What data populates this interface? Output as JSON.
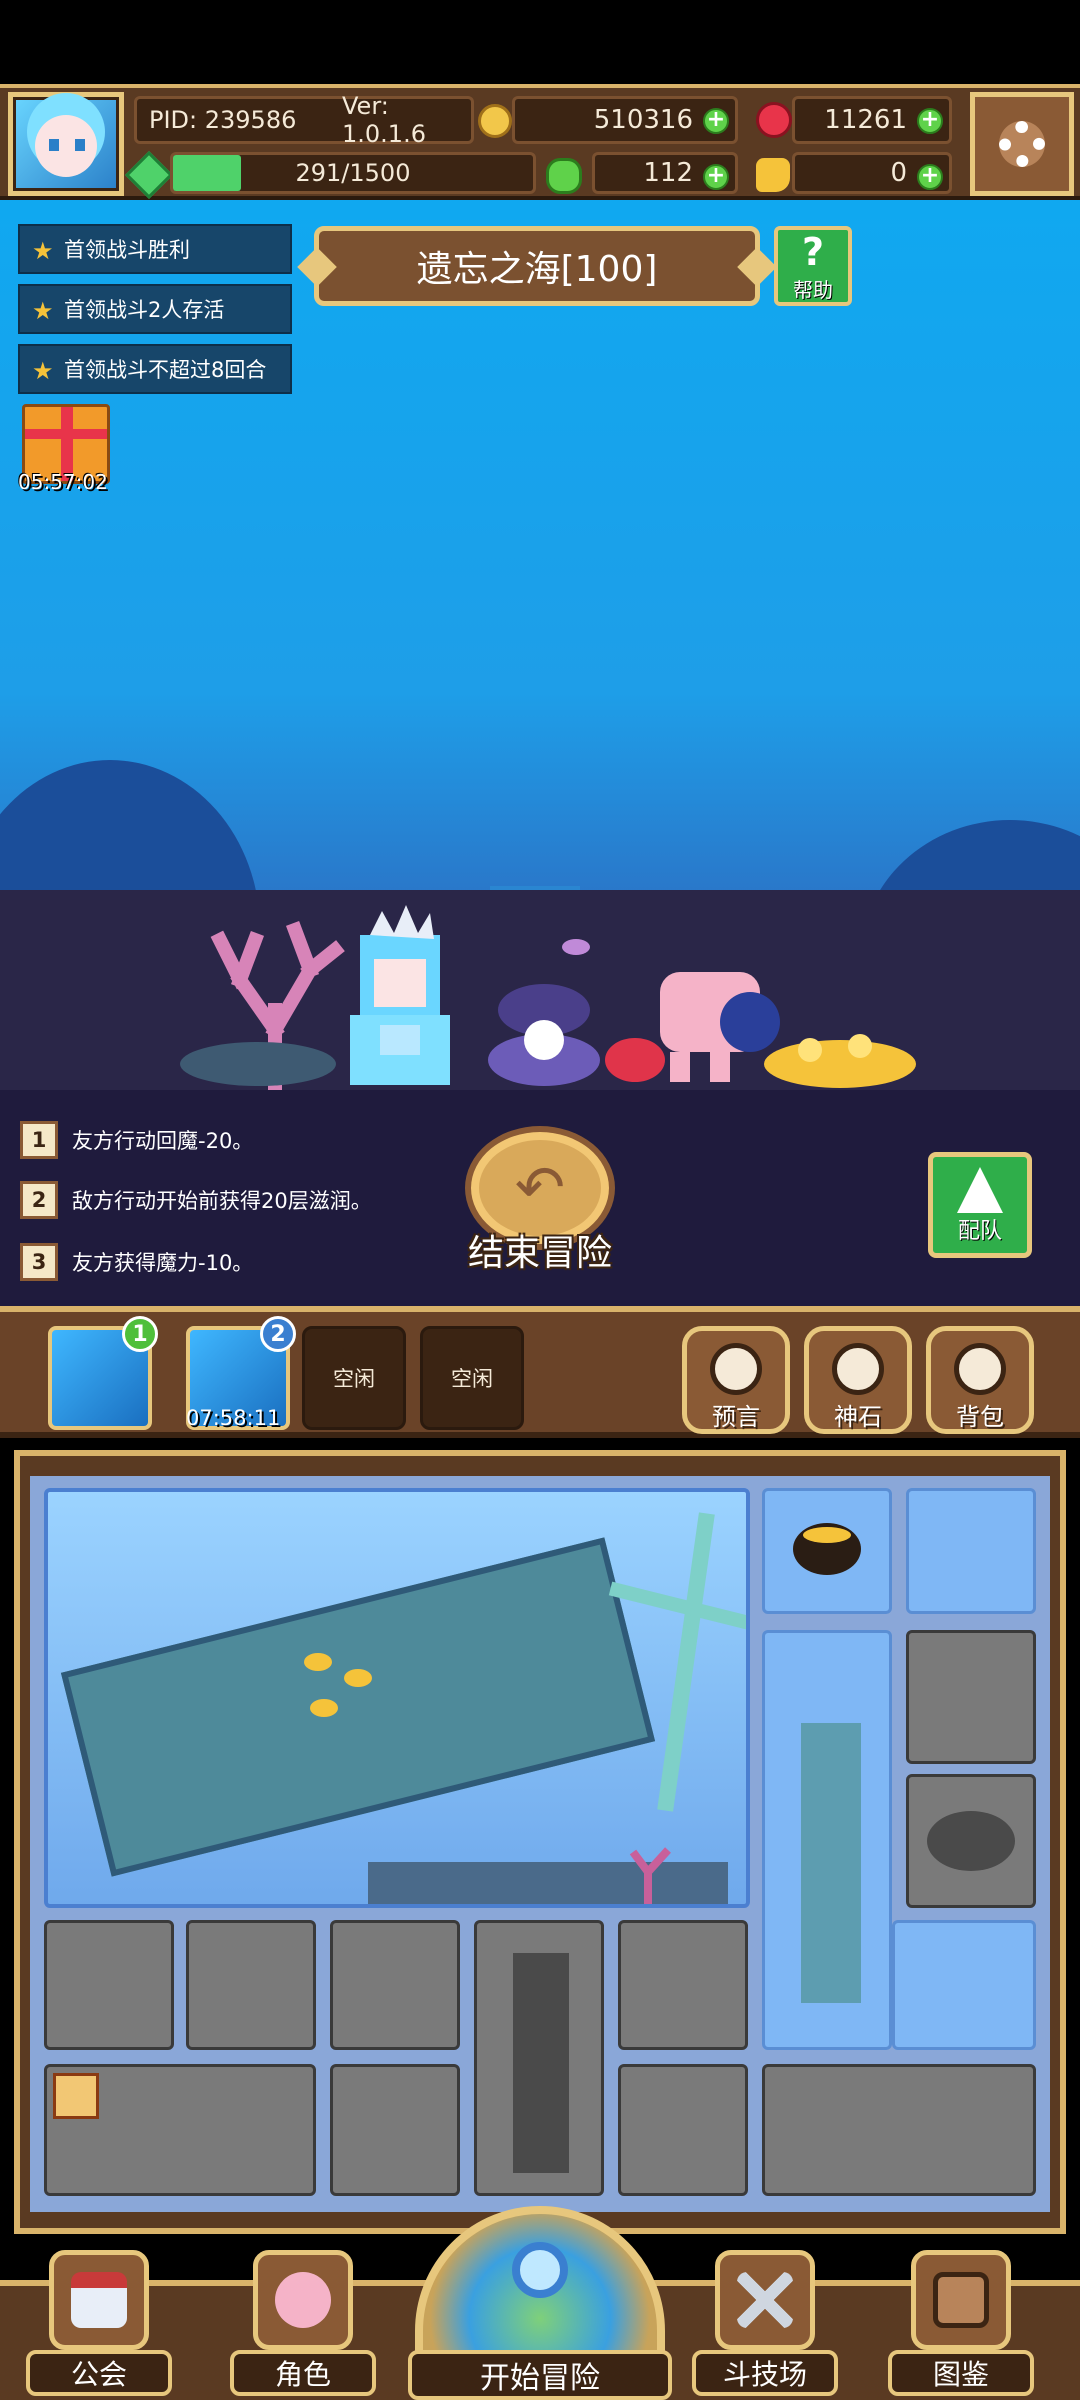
{
  "hud": {
    "pid": "PID: 239586",
    "version": "Ver: 1.0.1.6",
    "gold": "510316",
    "ruby": "11261",
    "energy": "291/1500",
    "energy_fraction": 0.19,
    "clover": "112",
    "hand": "0",
    "plus_symbol": "+"
  },
  "quests": [
    {
      "label": "首领战斗胜利"
    },
    {
      "label": "首领战斗2人存活"
    },
    {
      "label": "首领战斗不超过8回合"
    }
  ],
  "map": {
    "title": "遗忘之海[100]",
    "help_glyph": "?",
    "help_label": "帮助"
  },
  "gift": {
    "timer": "05:57:02"
  },
  "log": [
    {
      "num": "1",
      "text": "友方行动回魔-20。"
    },
    {
      "num": "2",
      "text": "敌方行动开始前获得20层滋润。"
    },
    {
      "num": "3",
      "text": "友方获得魔力-10。"
    }
  ],
  "end_button": {
    "label": "结束冒险",
    "glyph": "↶"
  },
  "team_button": {
    "label": "配队"
  },
  "slots": {
    "slot1_badge": "1",
    "slot2_badge": "2",
    "slot2_timer": "07:58:11",
    "idle1": "空闲",
    "idle2": "空闲"
  },
  "side_buttons": {
    "prophecy": "预言",
    "godstone": "神石",
    "backpack": "背包"
  },
  "nav": {
    "guild": "公会",
    "character": "角色",
    "start": "开始冒险",
    "arena": "斗技场",
    "codex": "图鉴"
  },
  "colors": {
    "sea_top": "#10a8f0",
    "wood": "#5a3a22",
    "gold_trim": "#e7c77d",
    "green": "#2fae4a"
  }
}
